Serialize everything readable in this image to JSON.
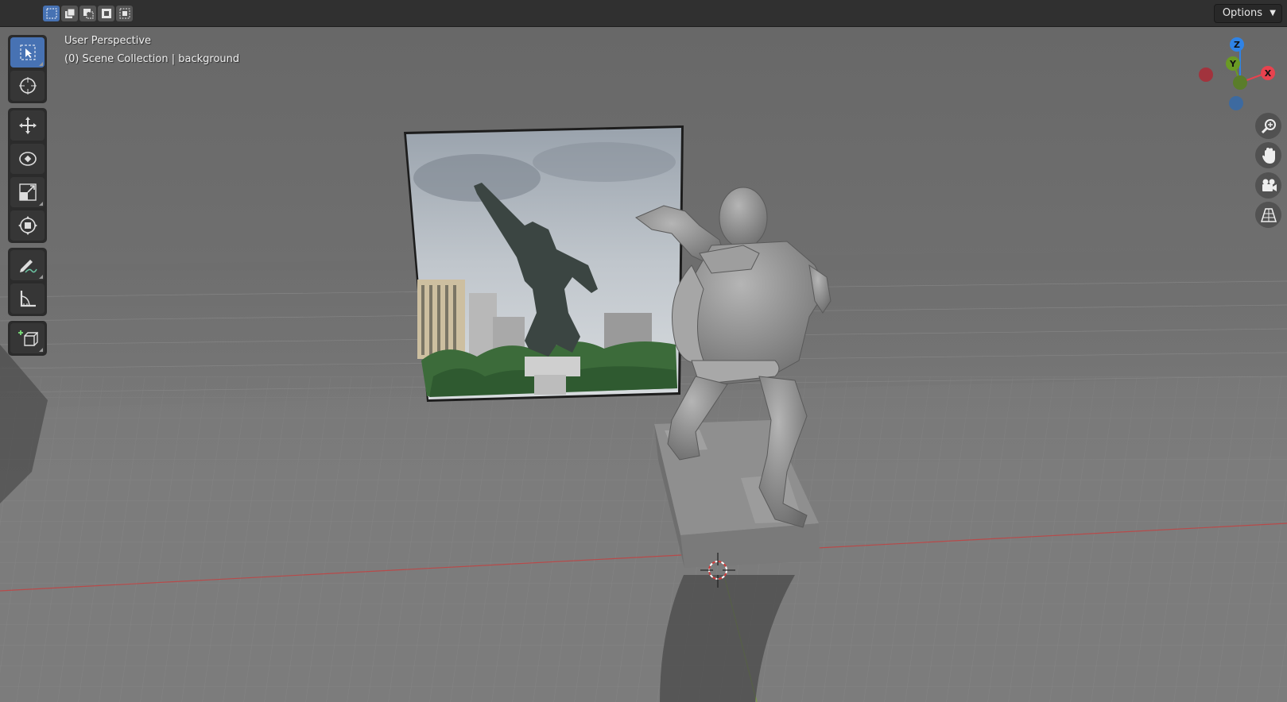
{
  "header": {
    "select_modes": [
      "set",
      "extend",
      "subtract",
      "invert",
      "intersect"
    ],
    "options_label": "Options",
    "options_chevron": "chevron-down-icon"
  },
  "viewport": {
    "view_name": "User Perspective",
    "collection_info": "(0) Scene Collection | background"
  },
  "toolbar": {
    "tools": [
      {
        "name": "select-box",
        "icon": "select-box-icon",
        "active": true
      },
      {
        "name": "cursor",
        "icon": "cursor-icon",
        "active": false
      },
      {
        "name": "move",
        "icon": "move-icon",
        "active": false
      },
      {
        "name": "rotate",
        "icon": "rotate-icon",
        "active": false
      },
      {
        "name": "scale",
        "icon": "scale-icon",
        "active": false
      },
      {
        "name": "transform",
        "icon": "transform-icon",
        "active": false
      },
      {
        "name": "annotate",
        "icon": "annotate-icon",
        "active": false
      },
      {
        "name": "measure",
        "icon": "measure-icon",
        "active": false
      },
      {
        "name": "add-cube",
        "icon": "add-cube-icon",
        "active": false
      }
    ]
  },
  "gizmo": {
    "axes": {
      "x": "X",
      "y": "Y",
      "z": "Z"
    },
    "colors": {
      "x": "#e8424e",
      "y": "#6a9a24",
      "z": "#2f83e6",
      "neg_x": "#a2333d",
      "neg_y": "#5a7d2a",
      "neg_z": "#3d6aa0"
    }
  },
  "navigation": [
    "zoom-icon",
    "pan-hand-icon",
    "camera-icon",
    "perspective-grid-icon"
  ],
  "colors": {
    "accent": "#4772b3",
    "header_bg": "#303030",
    "x_axis_line": "#b84a4a",
    "y_axis_line": "#7aa040"
  }
}
